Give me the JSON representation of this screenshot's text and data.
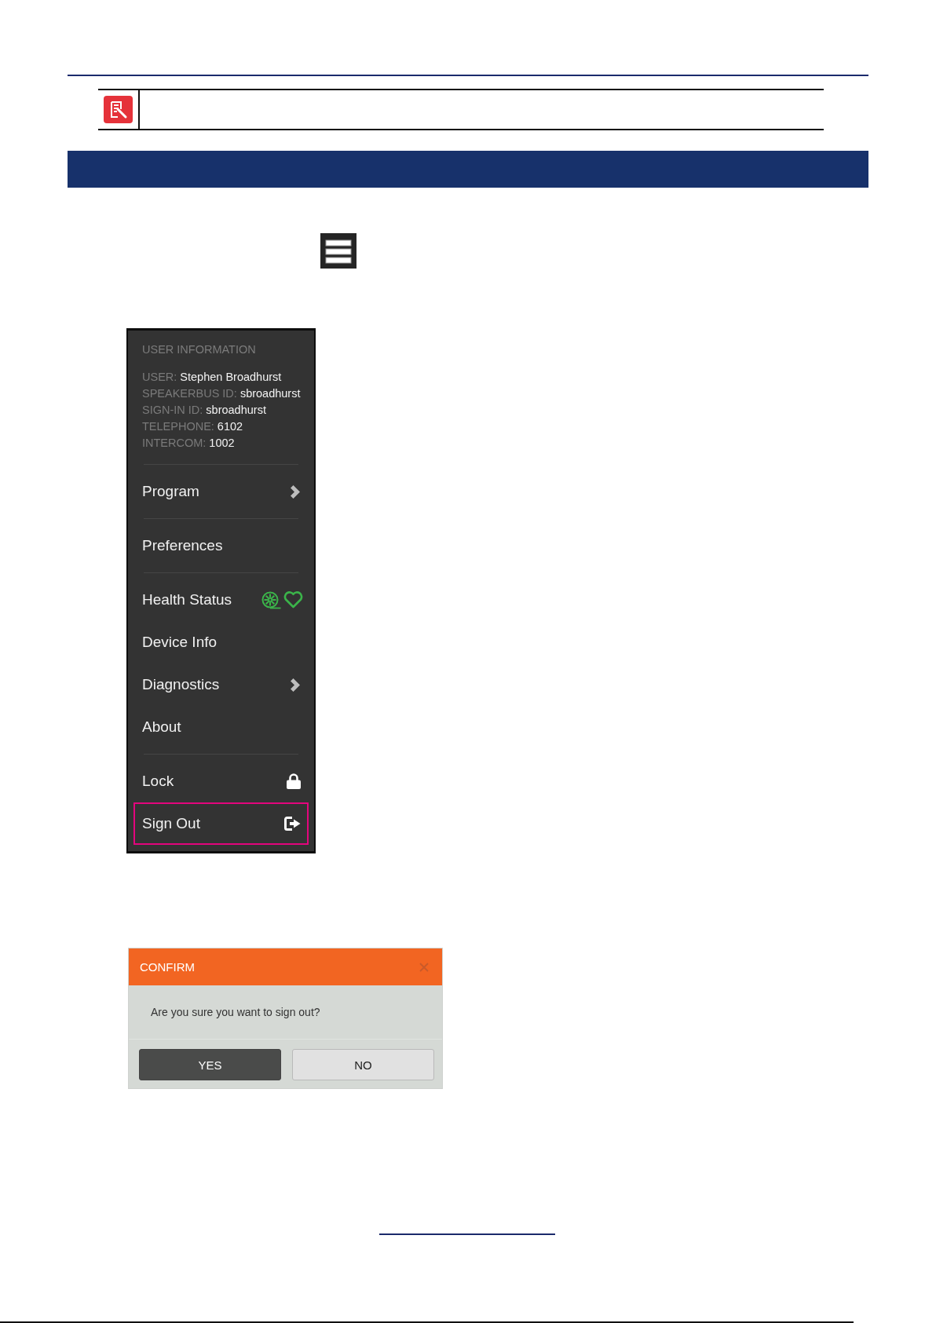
{
  "user_menu": {
    "heading": "USER INFORMATION",
    "fields": [
      {
        "label": "USER:",
        "value": "Stephen Broadhurst"
      },
      {
        "label": "SPEAKERBUS ID:",
        "value": "sbroadhurst"
      },
      {
        "label": "SIGN-IN ID:",
        "value": "sbroadhurst"
      },
      {
        "label": "TELEPHONE:",
        "value": "6102"
      },
      {
        "label": "INTERCOM:",
        "value": "1002"
      }
    ],
    "sections": [
      {
        "items": [
          {
            "label": "Program",
            "kind": "submenu",
            "highlighted": false
          }
        ]
      },
      {
        "items": [
          {
            "label": "Preferences",
            "kind": "plain",
            "highlighted": false
          }
        ]
      },
      {
        "items": [
          {
            "label": "Health Status",
            "kind": "status",
            "healthy": true,
            "highlighted": false
          },
          {
            "label": "Device Info",
            "kind": "plain",
            "highlighted": false
          },
          {
            "label": "Diagnostics",
            "kind": "submenu",
            "highlighted": false
          },
          {
            "label": "About",
            "kind": "plain",
            "highlighted": false
          }
        ]
      },
      {
        "items": [
          {
            "label": "Lock",
            "kind": "lock",
            "highlighted": false
          },
          {
            "label": "Sign Out",
            "kind": "exit",
            "highlighted": true
          }
        ]
      }
    ]
  },
  "confirm_dialog": {
    "title": "CONFIRM",
    "message": "Are you sure you want to sign out?",
    "buttons": [
      {
        "label": "YES",
        "kind": "primary"
      },
      {
        "label": "NO",
        "kind": "secondary"
      }
    ]
  }
}
